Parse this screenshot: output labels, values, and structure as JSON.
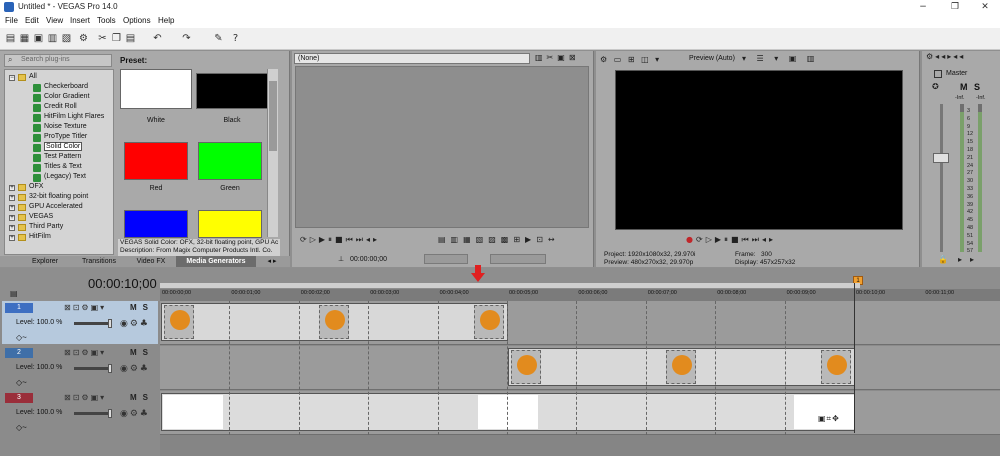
{
  "window": {
    "title": "Untitled * - VEGAS Pro 14.0",
    "minimize": "−",
    "maximize": "❐",
    "close": "✕"
  },
  "menu": [
    "File",
    "Edit",
    "View",
    "Insert",
    "Tools",
    "Options",
    "Help"
  ],
  "plugins": {
    "search_placeholder": "Search plug-ins",
    "tree": [
      {
        "label": "All",
        "type": "folder",
        "expander": "−"
      },
      {
        "label": "Checkerboard",
        "type": "child"
      },
      {
        "label": "Color Gradient",
        "type": "child"
      },
      {
        "label": "Credit Roll",
        "type": "child"
      },
      {
        "label": "HitFilm Light Flares",
        "type": "child"
      },
      {
        "label": "Noise Texture",
        "type": "child"
      },
      {
        "label": "ProType Titler",
        "type": "child"
      },
      {
        "label": "Solid Color",
        "type": "child",
        "selected": true
      },
      {
        "label": "Test Pattern",
        "type": "child"
      },
      {
        "label": "Titles & Text",
        "type": "child"
      },
      {
        "label": "(Legacy) Text",
        "type": "child"
      },
      {
        "label": "OFX",
        "type": "folder",
        "expander": "+"
      },
      {
        "label": "32-bit floating point",
        "type": "folder",
        "expander": "+"
      },
      {
        "label": "GPU Accelerated",
        "type": "folder",
        "expander": "+"
      },
      {
        "label": "VEGAS",
        "type": "folder",
        "expander": "+"
      },
      {
        "label": "Third Party",
        "type": "folder",
        "expander": "+"
      },
      {
        "label": "HitFilm",
        "type": "folder",
        "expander": "+"
      }
    ],
    "preset_title": "Preset:",
    "presets": [
      {
        "label": "White",
        "color": "#ffffff"
      },
      {
        "label": "Black",
        "color": "#000000"
      },
      {
        "label": "Red",
        "color": "#ff0000"
      },
      {
        "label": "Green",
        "color": "#00ff00"
      },
      {
        "label": "",
        "color": "#0000ff"
      },
      {
        "label": "",
        "color": "#ffff00"
      }
    ],
    "description_1": "VEGAS Solid Color: OFX, 32-bit floating point, GPU Ac",
    "description_2": "Description: From Magix Computer Products Intl. Co.",
    "tabs": [
      "Explorer",
      "Transitions",
      "Video FX",
      "Media Generators"
    ]
  },
  "trimmer": {
    "source": "(None)",
    "timecode": "00:00:00;00"
  },
  "preview": {
    "mode": "Preview (Auto)",
    "info": {
      "project_label": "Project:",
      "project_value": "1920x1080x32, 29.970i",
      "preview_label": "Preview:",
      "preview_value": "480x270x32, 29.970p",
      "frame_label": "Frame:",
      "frame_value": "300",
      "display_label": "Display:",
      "display_value": "457x257x32"
    }
  },
  "master": {
    "label": "Master",
    "m_label": "M",
    "s_label": "S",
    "inf_left": "-Inf.",
    "inf_right": "-Inf.",
    "db_scale": [
      "3",
      "6",
      "9",
      "12",
      "15",
      "18",
      "21",
      "24",
      "27",
      "30",
      "33",
      "36",
      "39",
      "42",
      "45",
      "48",
      "51",
      "54",
      "57"
    ]
  },
  "timeline": {
    "timecode": "00:00:10;00",
    "end_marker": "1",
    "ruler": [
      "00:00:00;00",
      "00:00:01;00",
      "00:00:02;00",
      "00:00:03;00",
      "00:00:04;00",
      "00:00:05;00",
      "00:00:06;00",
      "00:00:07;00",
      "00:00:08;00",
      "00:00:09;00",
      "00:00:10;00",
      "00:00:11;00"
    ],
    "tracks": [
      {
        "num": "1",
        "level": "Level: 100.0 %",
        "color": "#3d6fc2",
        "m": "M",
        "s": "S",
        "selected": true
      },
      {
        "num": "2",
        "level": "Level: 100.0 %",
        "color": "#3f6fa8",
        "m": "M",
        "s": "S",
        "selected": false
      },
      {
        "num": "3",
        "level": "Level: 100.0 %",
        "color": "#9a2e3a",
        "m": "M",
        "s": "S",
        "selected": false
      }
    ]
  },
  "colors": {
    "accent_playhead": "#e02020",
    "logo_orange": "#e28b1e"
  }
}
